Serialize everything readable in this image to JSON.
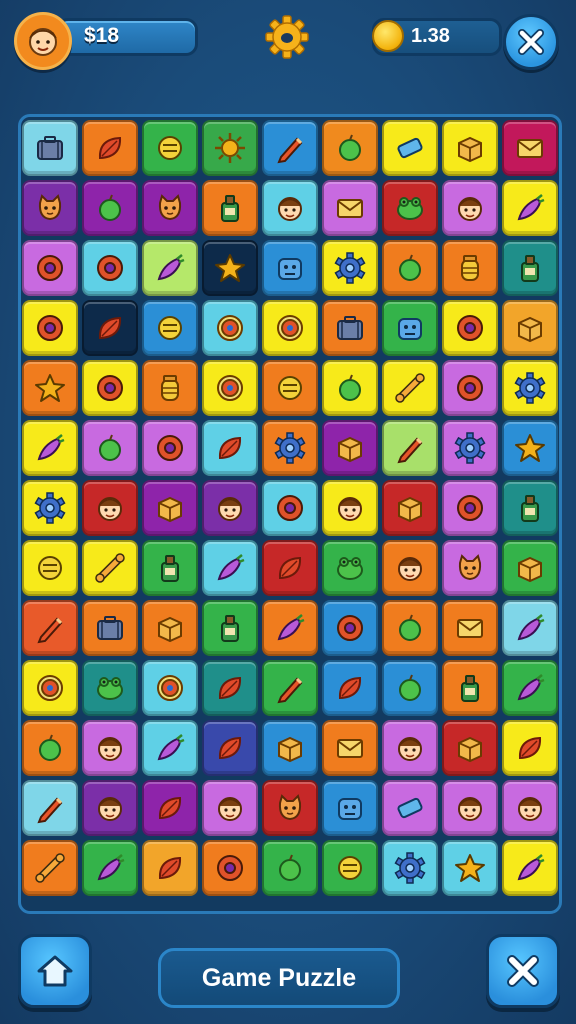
{
  "header": {
    "money": "$18",
    "coins": "1.38"
  },
  "footer": {
    "title": "Game Puzzle"
  },
  "colors": {
    "background": "#1a4b79",
    "accent_button": "#2b95e0",
    "coin": "#f3b20b",
    "avatar": "#f28a1e"
  },
  "icons": {
    "settings": "gear-icon",
    "close": "close-icon",
    "home": "home-icon",
    "coin": "coin-icon",
    "avatar": "player-avatar-icon"
  },
  "board": {
    "columns": 9,
    "rows": 13,
    "tiles": [
      [
        "#7fd6e8",
        "briefcase"
      ],
      [
        "#f07c1e",
        "leaf"
      ],
      [
        "#34b34a",
        "ball"
      ],
      [
        "#37a94a",
        "sun"
      ],
      [
        "#2b8fd6",
        "pencil"
      ],
      [
        "#f08a1e",
        "apple"
      ],
      [
        "#f7ea1a",
        "eraser"
      ],
      [
        "#f7ea1a",
        "box"
      ],
      [
        "#c2185b",
        "envelope"
      ],
      [
        "#7b2fa8",
        "cat"
      ],
      [
        "#8e24aa",
        "apple"
      ],
      [
        "#8e24aa",
        "cat"
      ],
      [
        "#f07c1e",
        "bottle"
      ],
      [
        "#5fd0e6",
        "face"
      ],
      [
        "#c86ae0",
        "envelope"
      ],
      [
        "#c62828",
        "frog"
      ],
      [
        "#c86ae0",
        "face"
      ],
      [
        "#f7ea1a",
        "carrot"
      ],
      [
        "#c86ae0",
        "donut"
      ],
      [
        "#5fd0e6",
        "donut"
      ],
      [
        "#b5e86a",
        "carrot"
      ],
      [
        "#0d2a4a",
        "star"
      ],
      [
        "#2b8fd6",
        "monster"
      ],
      [
        "#f7ea1a",
        "gear"
      ],
      [
        "#f07c1e",
        "apple"
      ],
      [
        "#f07c1e",
        "jar"
      ],
      [
        "#1f8f8a",
        "bottle"
      ],
      [
        "#f7ea1a",
        "donut"
      ],
      [
        "#0d2a4a",
        "leaf"
      ],
      [
        "#2b8fd6",
        "ball"
      ],
      [
        "#5fd0e6",
        "target"
      ],
      [
        "#f7ea1a",
        "target"
      ],
      [
        "#f07c1e",
        "briefcase"
      ],
      [
        "#34b34a",
        "monster"
      ],
      [
        "#f7ea1a",
        "donut"
      ],
      [
        "#f2a52a",
        "box"
      ],
      [
        "#f07c1e",
        "star"
      ],
      [
        "#f7ea1a",
        "donut"
      ],
      [
        "#f07c1e",
        "jar"
      ],
      [
        "#f7ea1a",
        "target"
      ],
      [
        "#f07c1e",
        "ball"
      ],
      [
        "#f7ea1a",
        "apple"
      ],
      [
        "#f7ea1a",
        "bone"
      ],
      [
        "#c86ae0",
        "donut"
      ],
      [
        "#f7ea1a",
        "gear"
      ],
      [
        "#f7ea1a",
        "carrot"
      ],
      [
        "#c86ae0",
        "apple"
      ],
      [
        "#c86ae0",
        "donut"
      ],
      [
        "#5fd0e6",
        "leaf"
      ],
      [
        "#f07c1e",
        "gear"
      ],
      [
        "#8e24aa",
        "box"
      ],
      [
        "#a8e06a",
        "pencil"
      ],
      [
        "#c86ae0",
        "gear"
      ],
      [
        "#2b8fd6",
        "star"
      ],
      [
        "#f7ea1a",
        "gear"
      ],
      [
        "#c62828",
        "face"
      ],
      [
        "#8e24aa",
        "box"
      ],
      [
        "#7b2fa8",
        "face"
      ],
      [
        "#5fd0e6",
        "donut"
      ],
      [
        "#f7ea1a",
        "face"
      ],
      [
        "#c62828",
        "box"
      ],
      [
        "#c86ae0",
        "donut"
      ],
      [
        "#1f8f8a",
        "bottle"
      ],
      [
        "#f7ea1a",
        "ball"
      ],
      [
        "#f7ea1a",
        "bone"
      ],
      [
        "#34b34a",
        "bottle"
      ],
      [
        "#5fd0e6",
        "carrot"
      ],
      [
        "#c62828",
        "leaf"
      ],
      [
        "#34b34a",
        "frog"
      ],
      [
        "#f07c1e",
        "face"
      ],
      [
        "#c86ae0",
        "cat"
      ],
      [
        "#34b34a",
        "box"
      ],
      [
        "#e85a2a",
        "pencil"
      ],
      [
        "#f07c1e",
        "briefcase"
      ],
      [
        "#f07c1e",
        "box"
      ],
      [
        "#34b34a",
        "bottle"
      ],
      [
        "#f07c1e",
        "carrot"
      ],
      [
        "#2b8fd6",
        "donut"
      ],
      [
        "#f07c1e",
        "apple"
      ],
      [
        "#f07c1e",
        "envelope"
      ],
      [
        "#7fd6e8",
        "carrot"
      ],
      [
        "#f7ea1a",
        "target"
      ],
      [
        "#1f8f8a",
        "frog"
      ],
      [
        "#5fd0e6",
        "target"
      ],
      [
        "#1f8f8a",
        "leaf"
      ],
      [
        "#34b34a",
        "pencil"
      ],
      [
        "#2b8fd6",
        "leaf"
      ],
      [
        "#2b8fd6",
        "apple"
      ],
      [
        "#f07c1e",
        "bottle"
      ],
      [
        "#34b34a",
        "carrot"
      ],
      [
        "#f07c1e",
        "apple"
      ],
      [
        "#c86ae0",
        "face"
      ],
      [
        "#5fd0e6",
        "carrot"
      ],
      [
        "#3949ab",
        "leaf"
      ],
      [
        "#2b8fd6",
        "box"
      ],
      [
        "#f07c1e",
        "envelope"
      ],
      [
        "#c86ae0",
        "face"
      ],
      [
        "#c62828",
        "box"
      ],
      [
        "#f7ea1a",
        "leaf"
      ],
      [
        "#7fd6e8",
        "pencil"
      ],
      [
        "#7b2fa8",
        "face"
      ],
      [
        "#8e24aa",
        "leaf"
      ],
      [
        "#c86ae0",
        "face"
      ],
      [
        "#c62828",
        "cat"
      ],
      [
        "#2b8fd6",
        "monster"
      ],
      [
        "#c86ae0",
        "eraser"
      ],
      [
        "#c86ae0",
        "face"
      ],
      [
        "#c86ae0",
        "face"
      ],
      [
        "#f07c1e",
        "bone"
      ],
      [
        "#34b34a",
        "carrot"
      ],
      [
        "#f2a52a",
        "leaf"
      ],
      [
        "#f07c1e",
        "donut"
      ],
      [
        "#34b34a",
        "apple"
      ],
      [
        "#34b34a",
        "ball"
      ],
      [
        "#5fd0e6",
        "gear"
      ],
      [
        "#5fd0e6",
        "star"
      ],
      [
        "#f7ea1a",
        "carrot"
      ]
    ]
  }
}
